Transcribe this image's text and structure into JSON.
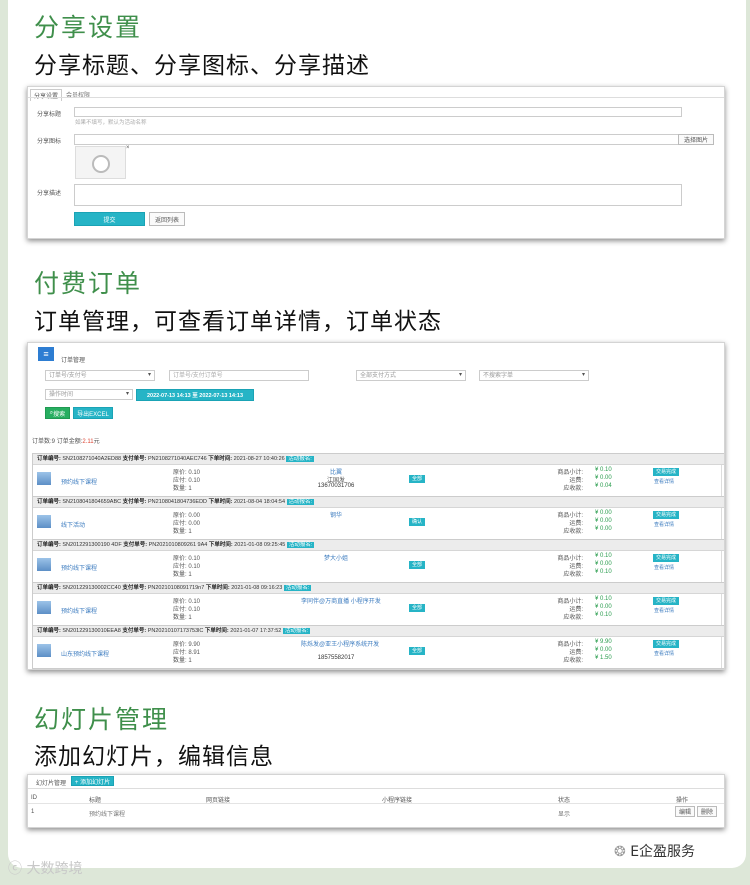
{
  "sections": [
    {
      "title": "分享设置",
      "subtitle": "分享标题、分享图标、分享描述"
    },
    {
      "title": "付费订单",
      "subtitle": "订单管理，可查看订单详情，订单状态"
    },
    {
      "title": "幻灯片管理",
      "subtitle": "添加幻灯片，编辑信息"
    }
  ],
  "share": {
    "tabs": [
      "分享设置",
      "会员权限"
    ],
    "title_label": "分享标题",
    "title_hint": "如果不填写，默认为活动名称",
    "icon_label": "分享图标",
    "choose_image": "选择图片",
    "close_x": "×",
    "desc_label": "分享描述",
    "submit": "提交",
    "back": "返回列表"
  },
  "orders": {
    "header": "订单管理",
    "filters": {
      "order_type": "订单号/支付号",
      "order_no_placeholder": "订单号/支付订单号",
      "pay_method": "全部支付方式",
      "search_all": "不搜索字单",
      "time_type": "操作时间",
      "date_range": "2022-07-13 14:13 至 2022-07-13 14:13"
    },
    "search_btn": "搜索",
    "export_btn": "导出EXCEL",
    "summary_label": "订单数:",
    "summary_count": "9",
    "amount_label": "订单金额:",
    "amount": "2.11",
    "amount_unit": "元",
    "list": [
      {
        "order_no": "SN2108271040A2ED88",
        "pay_no": "PN2108271040AEC746",
        "time": "2021-08-27 10:40:26",
        "tag": "活动报名:",
        "product": "预约线下课程",
        "orig": "原价: 0.10",
        "paid": "应付: 0.10",
        "qty": "数量: 1",
        "buyer": "比翼",
        "buyer2": "江国发",
        "phone": "13670031706",
        "status": "全部",
        "subtotal": "¥ 0.10",
        "freight": "¥ 0.00",
        "received": "¥ 0.04",
        "action": "交易完成",
        "detail": "查看详情"
      },
      {
        "order_no": "SN2108041804659ABC",
        "pay_no": "PN2108041804736EDD",
        "time": "2021-08-04 18:04:54",
        "tag": "活动报名:",
        "product": "线下活动",
        "orig": "原价: 0.00",
        "paid": "应付: 0.00",
        "qty": "数量: 1",
        "buyer": "钢华",
        "buyer2": "",
        "phone": "",
        "status": "确认",
        "subtotal": "¥ 0.00",
        "freight": "¥ 0.00",
        "received": "¥ 0.00",
        "action": "交易完成",
        "detail": "查看详情"
      },
      {
        "order_no": "SN2012291300190 4DF",
        "pay_no": "PN2021010809261 9A4",
        "time": "2021-01-08 09:25:45",
        "tag": "活动报名:",
        "product": "预约线下课程",
        "orig": "原价: 0.10",
        "paid": "应付: 0.10",
        "qty": "数量: 1",
        "buyer": "梦大小姐",
        "buyer2": "",
        "phone": "",
        "status": "全部",
        "subtotal": "¥ 0.10",
        "freight": "¥ 0.00",
        "received": "¥ 0.10",
        "action": "交易完成",
        "detail": "查看详情"
      },
      {
        "order_no": "SN201229130002CC40",
        "pay_no": "PN20210108091719n7",
        "time": "2021-01-08 09:16:23",
        "tag": "活动报名:",
        "product": "预约线下课程",
        "orig": "原价: 0.10",
        "paid": "应付: 0.10",
        "qty": "数量: 1",
        "buyer": "李同伴@万商直播 小程序开发",
        "buyer2": "",
        "phone": "",
        "status": "全部",
        "subtotal": "¥ 0.10",
        "freight": "¥ 0.00",
        "received": "¥ 0.10",
        "action": "交易完成",
        "detail": "查看详情"
      },
      {
        "order_no": "SN201229130010EEA8",
        "pay_no": "PN20210107173753lC",
        "time": "2021-01-07 17:37:52",
        "tag": "活动报名:",
        "product": "山东预约线下课程",
        "orig": "原价: 9.90",
        "paid": "应付: 8.91",
        "qty": "数量: 1",
        "buyer": "陈烁发@亚王小程序系统开发",
        "buyer2": "",
        "phone": "18575582017",
        "status": "全部",
        "subtotal": "¥ 9.90",
        "freight": "¥ 0.00",
        "received": "¥ 1.50",
        "action": "交易完成",
        "detail": "查看详情"
      }
    ],
    "labels": {
      "order_no": "订单编号:",
      "pay_no": "支付单号:",
      "time": "下单时间:",
      "subtotal": "商品小计:",
      "freight": "运费:",
      "received": "应收款:"
    }
  },
  "slides": {
    "tab": "幻灯片管理",
    "add_btn": "+ 添加幻灯片",
    "columns": [
      "ID",
      "标题",
      "网页链接",
      "小程序链接",
      "状态",
      "操作"
    ],
    "rows": [
      {
        "id": "1",
        "title": "预约线下课程",
        "url": "",
        "mini": "",
        "status": "显示",
        "edit": "编辑",
        "del": "删除"
      }
    ]
  },
  "watermark_left": "大数跨境",
  "watermark_right": "E企盈服务"
}
